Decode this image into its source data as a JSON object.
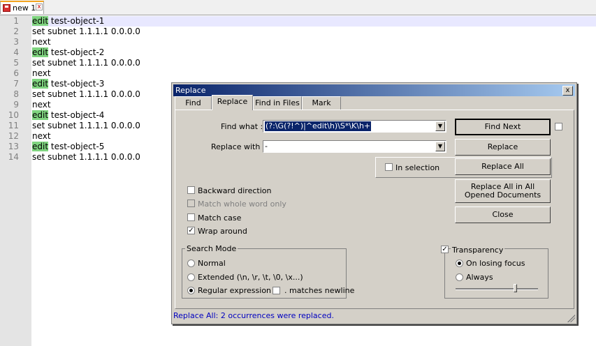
{
  "tab": {
    "title": "new 1"
  },
  "editor": {
    "lines": [
      {
        "num": "1",
        "kw": "edit",
        "rest": " test-object-1"
      },
      {
        "num": "2",
        "kw": "",
        "rest": "set subnet 1.1.1.1 0.0.0.0"
      },
      {
        "num": "3",
        "kw": "",
        "rest": "next"
      },
      {
        "num": "4",
        "kw": "edit",
        "rest": " test-object-2"
      },
      {
        "num": "5",
        "kw": "",
        "rest": "set subnet 1.1.1.1 0.0.0.0"
      },
      {
        "num": "6",
        "kw": "",
        "rest": "next"
      },
      {
        "num": "7",
        "kw": "edit",
        "rest": " test-object-3"
      },
      {
        "num": "8",
        "kw": "",
        "rest": "set subnet 1.1.1.1 0.0.0.0"
      },
      {
        "num": "9",
        "kw": "",
        "rest": "next"
      },
      {
        "num": "10",
        "kw": "edit",
        "rest": " test-object-4"
      },
      {
        "num": "11",
        "kw": "",
        "rest": "set subnet 1.1.1.1 0.0.0.0"
      },
      {
        "num": "12",
        "kw": "",
        "rest": "next"
      },
      {
        "num": "13",
        "kw": "edit",
        "rest": " test-object-5"
      },
      {
        "num": "14",
        "kw": "",
        "rest": "set subnet 1.1.1.1 0.0.0.0"
      }
    ]
  },
  "dialog": {
    "title": "Replace",
    "close": "x",
    "tabs": [
      "Find",
      "Replace",
      "Find in Files",
      "Mark"
    ],
    "find_label": "Find what :",
    "find_value": "(?:\\G(?!^)|^edit\\h)\\S*\\K\\h+",
    "replace_label": "Replace with :",
    "replace_value": "-",
    "in_selection": "In selection",
    "buttons": {
      "find_next": "Find Next",
      "replace": "Replace",
      "replace_all": "Replace All",
      "replace_all_docs_1": "Replace All in All",
      "replace_all_docs_2": "Opened Documents",
      "close": "Close"
    },
    "options": {
      "backward": "Backward direction",
      "whole_word": "Match whole word only",
      "match_case": "Match case",
      "wrap": "Wrap around"
    },
    "search_mode": {
      "label": "Search Mode",
      "normal": "Normal",
      "extended": "Extended (\\n, \\r, \\t, \\0, \\x...)",
      "regex": "Regular expression",
      "newline": ". matches newline"
    },
    "transparency": {
      "label": "Transparency",
      "on_losing_focus": "On losing focus",
      "always": "Always",
      "level": 0.72
    },
    "status": "Replace All: 2 occurrences were replaced.",
    "check_mark": "✓",
    "arrow": "▼"
  }
}
